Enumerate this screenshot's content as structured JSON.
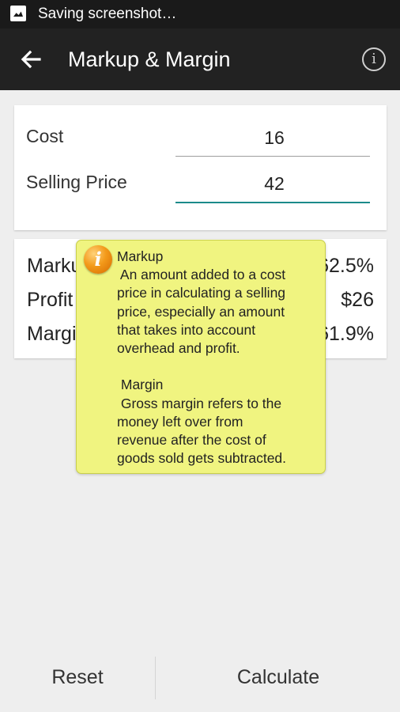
{
  "status_bar": {
    "text": "Saving screenshot…",
    "icon": "screenshot-icon"
  },
  "app_bar": {
    "title": "Markup & Margin",
    "back_icon": "arrow-back-icon",
    "info_icon": "info-icon"
  },
  "inputs": {
    "cost": {
      "label": "Cost",
      "value": "16"
    },
    "selling_price": {
      "label": "Selling Price",
      "value": "42"
    }
  },
  "results": {
    "markup": {
      "label": "Markup",
      "value": "162.5%"
    },
    "profit": {
      "label": "Profit",
      "value": "$26"
    },
    "margin": {
      "label": "Margin",
      "value": "61.9%"
    }
  },
  "tooltip": {
    "icon": "info-orange-icon",
    "text": "Markup\n An amount added to a cost\nprice in calculating a selling\nprice, especially an amount\nthat takes into account\noverhead and profit.\n\n Margin\n Gross margin refers to the\nmoney left over from\nrevenue after the cost of\ngoods sold gets subtracted."
  },
  "buttons": {
    "reset": "Reset",
    "calculate": "Calculate"
  },
  "colors": {
    "accent": "#1b8a8a",
    "tooltip_bg": "#f0f480",
    "app_bar": "#222222"
  }
}
